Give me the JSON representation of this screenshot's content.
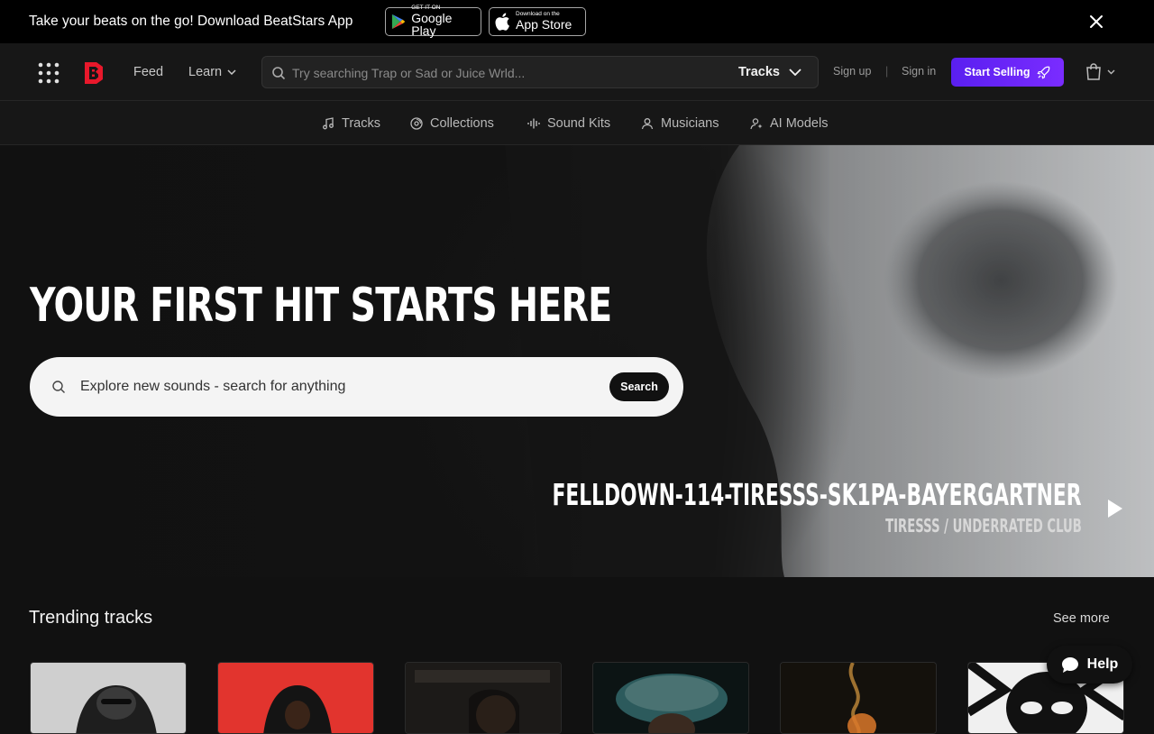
{
  "promo": {
    "text": "Take your beats on the go! Download BeatStars App",
    "google_play": {
      "small": "GET IT ON",
      "big": "Google Play"
    },
    "app_store": {
      "small": "Download on the",
      "big": "App Store"
    }
  },
  "header": {
    "nav": {
      "feed": "Feed",
      "learn": "Learn"
    },
    "search": {
      "placeholder": "Try searching Trap or Sad or Juice Wrld...",
      "scope": "Tracks"
    },
    "auth": {
      "signup": "Sign up",
      "separator": "|",
      "signin": "Sign in"
    },
    "start_selling": "Start Selling",
    "accent_color": "#6a24f8",
    "brand_color": "#e8182b"
  },
  "categories": [
    {
      "label": "Tracks",
      "icon": "music-note-icon"
    },
    {
      "label": "Collections",
      "icon": "disc-icon"
    },
    {
      "label": "Sound Kits",
      "icon": "waveform-icon"
    },
    {
      "label": "Musicians",
      "icon": "user-icon"
    },
    {
      "label": "AI Models",
      "icon": "ai-user-icon"
    }
  ],
  "hero": {
    "title": "YOUR FIRST HIT STARTS HERE",
    "search_placeholder": "Explore new sounds - search for anything",
    "search_button": "Search",
    "featured_track": {
      "title": "FELLDOWN-114-TIRESSS-SK1PA-BAYERGARTNER",
      "artist": "TIRESSS / UNDERRATED CLUB"
    }
  },
  "trending": {
    "title": "Trending tracks",
    "see_more": "See more"
  },
  "help": {
    "label": "Help"
  }
}
